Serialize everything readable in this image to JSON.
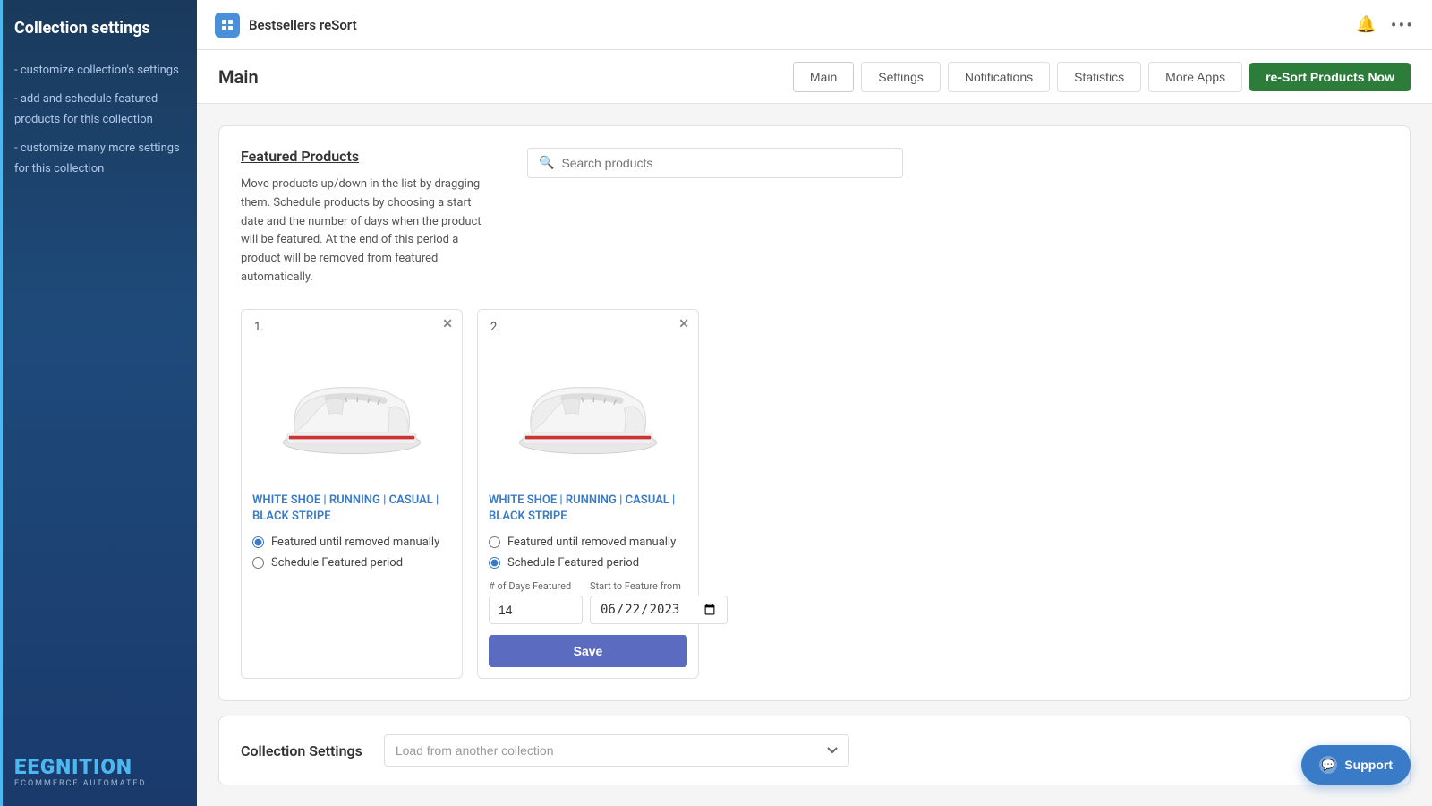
{
  "sidebar": {
    "title": "Collection settings",
    "nav_items": [
      "- customize collection's settings",
      "- add and schedule featured products for this collection",
      "- customize many more settings for this collection"
    ],
    "logo_main": "EGNITION",
    "logo_sub": "ECOMMERCE AUTOMATED"
  },
  "topbar": {
    "app_name": "Bestsellers reSort",
    "bell_icon": "🔔",
    "more_icon": "•••"
  },
  "page": {
    "title": "Main",
    "tabs": [
      {
        "id": "main",
        "label": "Main",
        "active": true
      },
      {
        "id": "settings",
        "label": "Settings"
      },
      {
        "id": "notifications",
        "label": "Notifications"
      },
      {
        "id": "statistics",
        "label": "Statistics"
      },
      {
        "id": "more_apps",
        "label": "More Apps"
      }
    ],
    "cta_button": "re-Sort Products Now"
  },
  "featured_products": {
    "title": "Featured Products",
    "description": "Move products up/down in the list by dragging them. Schedule products by choosing a start date and the number of days when the product will be featured. At the end of this period a product will be removed from featured automatically.",
    "search_placeholder": "Search products",
    "products": [
      {
        "number": "1.",
        "name": "WHITE SHOE | RUNNING | CASUAL | BLACK STRIPE",
        "radio_option1": "Featured until removed manually",
        "radio_option2": "Schedule Featured period",
        "selected_option": "option1",
        "has_schedule": false
      },
      {
        "number": "2.",
        "name": "WHITE SHOE | RUNNING | CASUAL | BLACK STRIPE",
        "radio_option1": "Featured until removed manually",
        "radio_option2": "Schedule Featured period",
        "selected_option": "option2",
        "has_schedule": true,
        "days_label": "# of Days Featured",
        "date_label": "Start to Feature from",
        "days_value": "14",
        "date_value": "22/06/2023",
        "save_label": "Save"
      }
    ]
  },
  "collection_settings": {
    "title": "Collection Settings",
    "select_placeholder": "Load from another collection"
  },
  "support": {
    "label": "Support"
  }
}
